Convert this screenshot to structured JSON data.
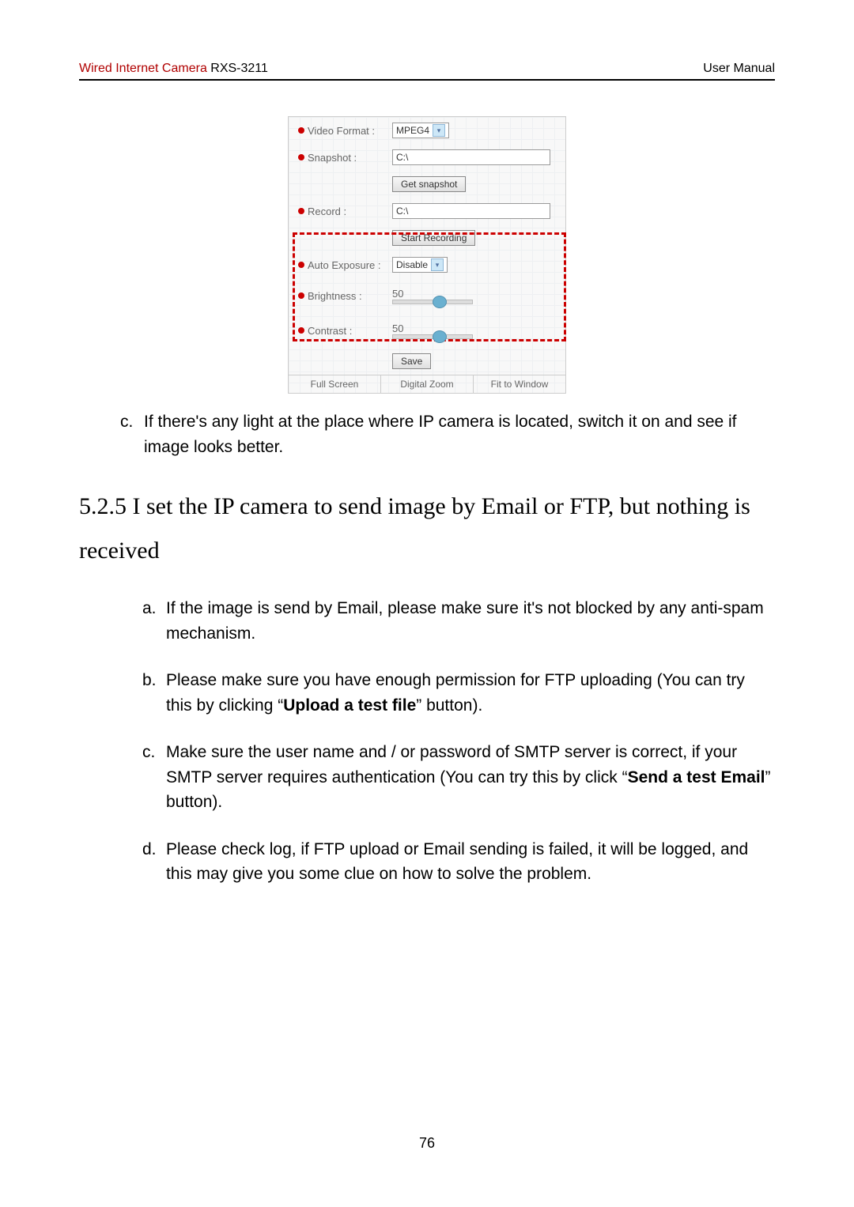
{
  "header": {
    "product_line": "Wired Internet Camera ",
    "model": "RXS-3211",
    "right": "User Manual"
  },
  "settings_panel": {
    "video_format": {
      "label": "Video Format :",
      "value": "MPEG4"
    },
    "snapshot": {
      "label": "Snapshot :",
      "value": "C:\\",
      "button": "Get snapshot"
    },
    "record": {
      "label": "Record :",
      "value": "C:\\",
      "button": "Start Recording"
    },
    "auto_exposure": {
      "label": "Auto Exposure :",
      "value": "Disable"
    },
    "brightness": {
      "label": "Brightness :",
      "value": "50"
    },
    "contrast": {
      "label": "Contrast :",
      "value": "50"
    },
    "save": "Save",
    "bottom": {
      "full_screen": "Full Screen",
      "digital_zoom": "Digital Zoom",
      "fit": "Fit to Window"
    }
  },
  "intro_item": {
    "marker": "c.",
    "text": "If there's any light at the place where IP camera is located, switch it on and see if image looks better."
  },
  "heading": "5.2.5 I set the IP camera to send image by Email or FTP, but nothing is received",
  "items": {
    "a": {
      "marker": "a.",
      "text": "If the image is send by Email, please make sure it's not blocked by any anti-spam mechanism."
    },
    "b": {
      "marker": "b.",
      "pre": "Please make sure you have enough permission for FTP uploading (You can try this by clicking “",
      "bold": "Upload a test file",
      "post": "” button)."
    },
    "c": {
      "marker": "c.",
      "pre": "Make sure the user name and / or password of SMTP server is correct, if your SMTP server requires authentication (You can try this by click “",
      "bold": "Send a test Email",
      "post": "” button)."
    },
    "d": {
      "marker": "d.",
      "text": "Please check log, if FTP upload or Email sending is failed, it will be logged, and this may give you some clue on how to solve the problem."
    }
  },
  "page_number": "76"
}
